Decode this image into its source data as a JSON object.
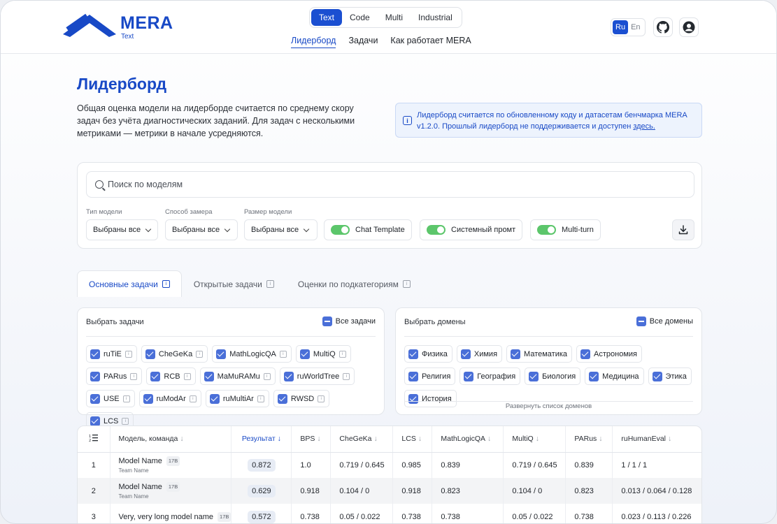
{
  "brand": {
    "title": "MERA",
    "subtitle": "Text",
    "accent": "#1849c6"
  },
  "modality_tabs": [
    "Text",
    "Code",
    "Multi",
    "Industrial"
  ],
  "nav": [
    "Лидерборд",
    "Задачи",
    "Как работает MERA"
  ],
  "lang": [
    "Ru",
    "En"
  ],
  "icons": {
    "github": "github-icon",
    "user": "user-icon"
  },
  "page": {
    "title": "Лидерборд",
    "description": "Общая оценка модели на лидерборде считается по среднему скору задач без учёта диагностических заданий. Для задач с несколькими метриками — метрики в начале усредняются.",
    "notice_text": "Лидерборд считается по обновленному коду и датасетам бенчмарка MERA v1.2.0. Прошлый лидерборд не поддерживается и доступен ",
    "notice_link": "здесь."
  },
  "filters": {
    "search_placeholder": "Поиск по моделям",
    "model_type_label": "Тип модели",
    "model_type_value": "Выбраны все",
    "method_label": "Способ замера",
    "method_value": "Выбраны все",
    "size_label": "Размер модели",
    "size_value": "Выбраны все",
    "toggles": [
      "Chat Template",
      "Системный промт",
      "Multi-turn"
    ]
  },
  "tabs": [
    "Основные задачи",
    "Открытые задачи",
    "Оценки по подкатегориям"
  ],
  "tasks_panel": {
    "title": "Выбрать задачи",
    "all_label": "Все задачи",
    "items": [
      "ruTiE",
      "CheGeKa",
      "MathLogicQA",
      "MultiQ",
      "PARus",
      "RCB",
      "MaMuRAMu",
      "ruWorldTree",
      "USE",
      "ruModAr",
      "ruMultiAr",
      "RWSD",
      "LCS"
    ]
  },
  "domains_panel": {
    "title": "Выбрать домены",
    "all_label": "Все домены",
    "items": [
      "Физика",
      "Химия",
      "Математика",
      "Астрономия",
      "Религия",
      "География",
      "Биология",
      "Медицина",
      "Этика",
      "История"
    ],
    "expand_label": "Развернуть список доменов"
  },
  "table": {
    "columns": [
      "Модель, команда",
      "Результат",
      "BPS",
      "CheGeKa",
      "LCS",
      "MathLogicQA",
      "MultiQ",
      "PARus",
      "ruHumanEval"
    ],
    "rows": [
      {
        "idx": "1",
        "model": "Model Name",
        "size": "17B",
        "team": "Team Name",
        "result": "0.872",
        "cells": [
          "1.0",
          "0.719 / 0.645",
          "0.985",
          "0.839",
          "0.719 / 0.645",
          "0.839",
          "1 / 1 / 1"
        ]
      },
      {
        "idx": "2",
        "model": "Model Name",
        "size": "17B",
        "team": "Team Name",
        "result": "0.629",
        "cells": [
          "0.918",
          "0.104 / 0",
          "0.918",
          "0.823",
          "0.104 / 0",
          "0.823",
          "0.013 / 0.064 / 0.128"
        ]
      },
      {
        "idx": "3",
        "model": "Very, very long model name",
        "size": "17B",
        "team": "",
        "result": "0.572",
        "cells": [
          "0.738",
          "0.05 / 0.022",
          "0.738",
          "0.738",
          "0.05 / 0.022",
          "0.738",
          "0.023 / 0.113 / 0.226"
        ]
      }
    ]
  }
}
